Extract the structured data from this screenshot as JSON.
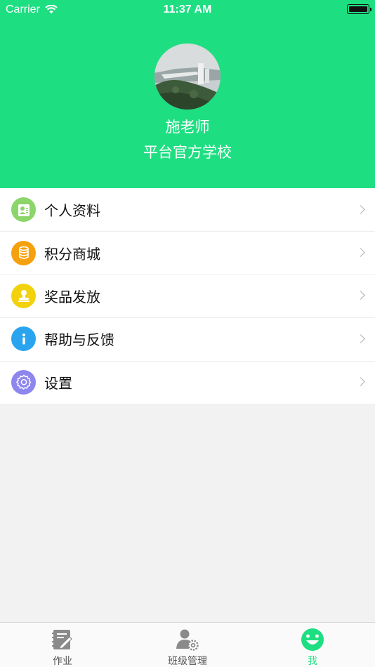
{
  "status_bar": {
    "carrier": "Carrier",
    "time": "11:37 AM"
  },
  "profile": {
    "name": "施老师",
    "school": "平台官方学校"
  },
  "menu": [
    {
      "label": "个人资料",
      "icon": "profile-card-icon",
      "color": "#8bd56a"
    },
    {
      "label": "积分商城",
      "icon": "coins-icon",
      "color": "#f5a10d"
    },
    {
      "label": "奖品发放",
      "icon": "stamp-icon",
      "color": "#f2d20c"
    },
    {
      "label": "帮助与反馈",
      "icon": "info-icon",
      "color": "#2aa4ee"
    },
    {
      "label": "设置",
      "icon": "gear-icon",
      "color": "#8d86ee"
    }
  ],
  "tabbar": [
    {
      "label": "作业",
      "icon": "homework-icon",
      "active": false
    },
    {
      "label": "班级管理",
      "icon": "class-management-icon",
      "active": false
    },
    {
      "label": "我",
      "icon": "me-smile-icon",
      "active": true
    }
  ],
  "colors": {
    "accent": "#1ede82",
    "background": "#f2f2f2"
  }
}
